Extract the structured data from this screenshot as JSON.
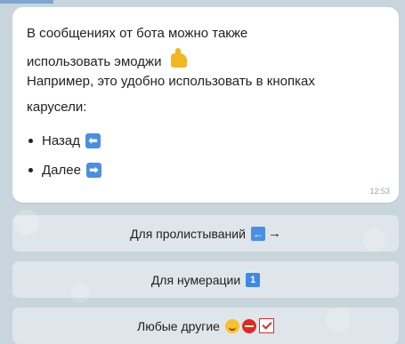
{
  "message": {
    "lines": [
      "В сообщениях от бота можно также",
      "использовать эмоджи",
      "Например, это удобно использовать в кнопках",
      "карусели:"
    ],
    "bullets": [
      {
        "label": "Назад",
        "icon": "left-arrow-emoji-icon",
        "glyph": "⬅"
      },
      {
        "label": "Далее",
        "icon": "right-arrow-emoji-icon",
        "glyph": "➡"
      }
    ],
    "time": "12:53",
    "thumb_icon": "thumbs-up-emoji-icon"
  },
  "keyboard": {
    "buttons": [
      {
        "label": "Для пролистываний",
        "icons": [
          "left-arrow-emoji-icon",
          "right-arrow-emoji-icon"
        ]
      },
      {
        "label": "Для нумерации",
        "icons": [
          "number-one-emoji-icon"
        ]
      },
      {
        "label": "Любые другие",
        "icons": [
          "smile-emoji-icon",
          "no-entry-emoji-icon",
          "check-emoji-icon"
        ]
      }
    ]
  },
  "colors": {
    "chat_background": "#c8d5dc",
    "bubble": "#ffffff",
    "keyboard_button": "#ffffff",
    "emoji_blue": "#4a90e2"
  }
}
